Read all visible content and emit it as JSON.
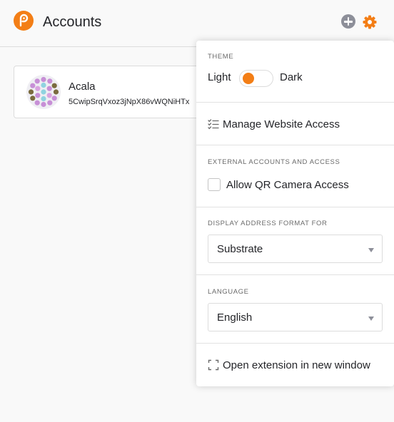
{
  "header": {
    "title": "Accounts",
    "logo_icon": "polkadot-logo-icon",
    "add_icon": "add-circle-icon",
    "settings_icon": "gear-icon",
    "accent_color": "#f37e16"
  },
  "account": {
    "name": "Acala",
    "address": "5CwipSrqVxoz3jNpX86vWQNiHTx",
    "identicon_icon": "identicon-icon"
  },
  "settings": {
    "theme": {
      "title": "THEME",
      "light_label": "Light",
      "dark_label": "Dark",
      "selected": "Light"
    },
    "manage_website_access": {
      "label": "Manage Website Access",
      "icon": "checklist-icon"
    },
    "external_accounts": {
      "title": "EXTERNAL ACCOUNTS AND ACCESS",
      "allow_qr_label": "Allow QR Camera Access",
      "allow_qr_checked": false
    },
    "address_format": {
      "title": "DISPLAY ADDRESS FORMAT FOR",
      "selected": "Substrate"
    },
    "language": {
      "title": "LANGUAGE",
      "selected": "English"
    },
    "open_extension": {
      "label": "Open extension in new window",
      "icon": "expand-icon"
    }
  }
}
